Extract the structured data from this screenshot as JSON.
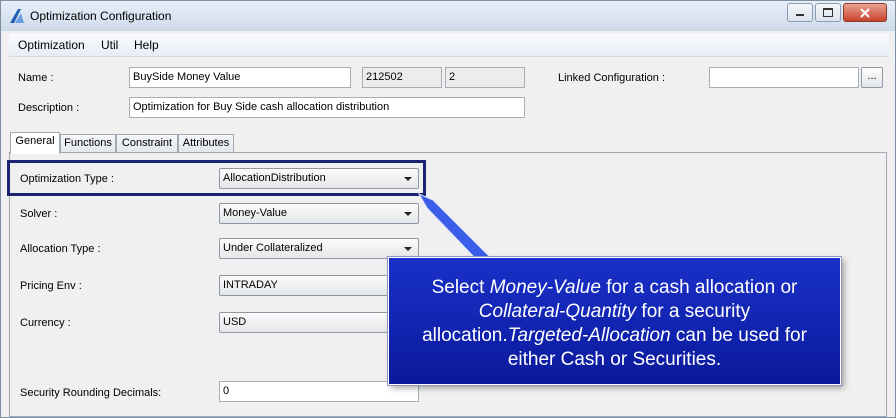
{
  "window": {
    "title": "Optimization Configuration",
    "icon": "app-logo-icon",
    "controls": [
      "minimize-icon",
      "maximize-icon",
      "close-icon"
    ]
  },
  "menu": {
    "items": [
      "Optimization",
      "Util",
      "Help"
    ]
  },
  "header": {
    "name_label": "Name :",
    "name_value": "BuySide Money Value",
    "id_value": "212502",
    "version_value": "2",
    "linked_label": "Linked Configuration :",
    "linked_value": "",
    "browse_label": "...",
    "description_label": "Description :",
    "description_value": "Optimization for Buy Side cash allocation distribution"
  },
  "tabs": [
    {
      "label": "General",
      "active": true
    },
    {
      "label": "Functions",
      "active": false
    },
    {
      "label": "Constraint",
      "active": false
    },
    {
      "label": "Attributes",
      "active": false
    }
  ],
  "general": {
    "optimization_type_label": "Optimization Type :",
    "optimization_type_value": "AllocationDistribution",
    "solver_label": "Solver :",
    "solver_value": "Money-Value",
    "allocation_type_label": "Allocation Type :",
    "allocation_type_value": "Under Collateralized",
    "pricing_env_label": "Pricing Env :",
    "pricing_env_value": "INTRADAY",
    "currency_label": "Currency :",
    "currency_value": "USD",
    "rounding_label": "Security Rounding Decimals:",
    "rounding_value": "0"
  },
  "callout": {
    "part1": "Select ",
    "money_value": "Money-Value",
    "part2": " for a cash allocation or ",
    "collateral_quantity": "Collateral-Quantity",
    "part3": " for a security allocation.",
    "targeted_allocation": "Targeted-Allocation",
    "part4": " can be used for either Cash or Securities."
  },
  "colors": {
    "callout_bg": "#0f22b4",
    "highlight_border": "#1a2470"
  }
}
